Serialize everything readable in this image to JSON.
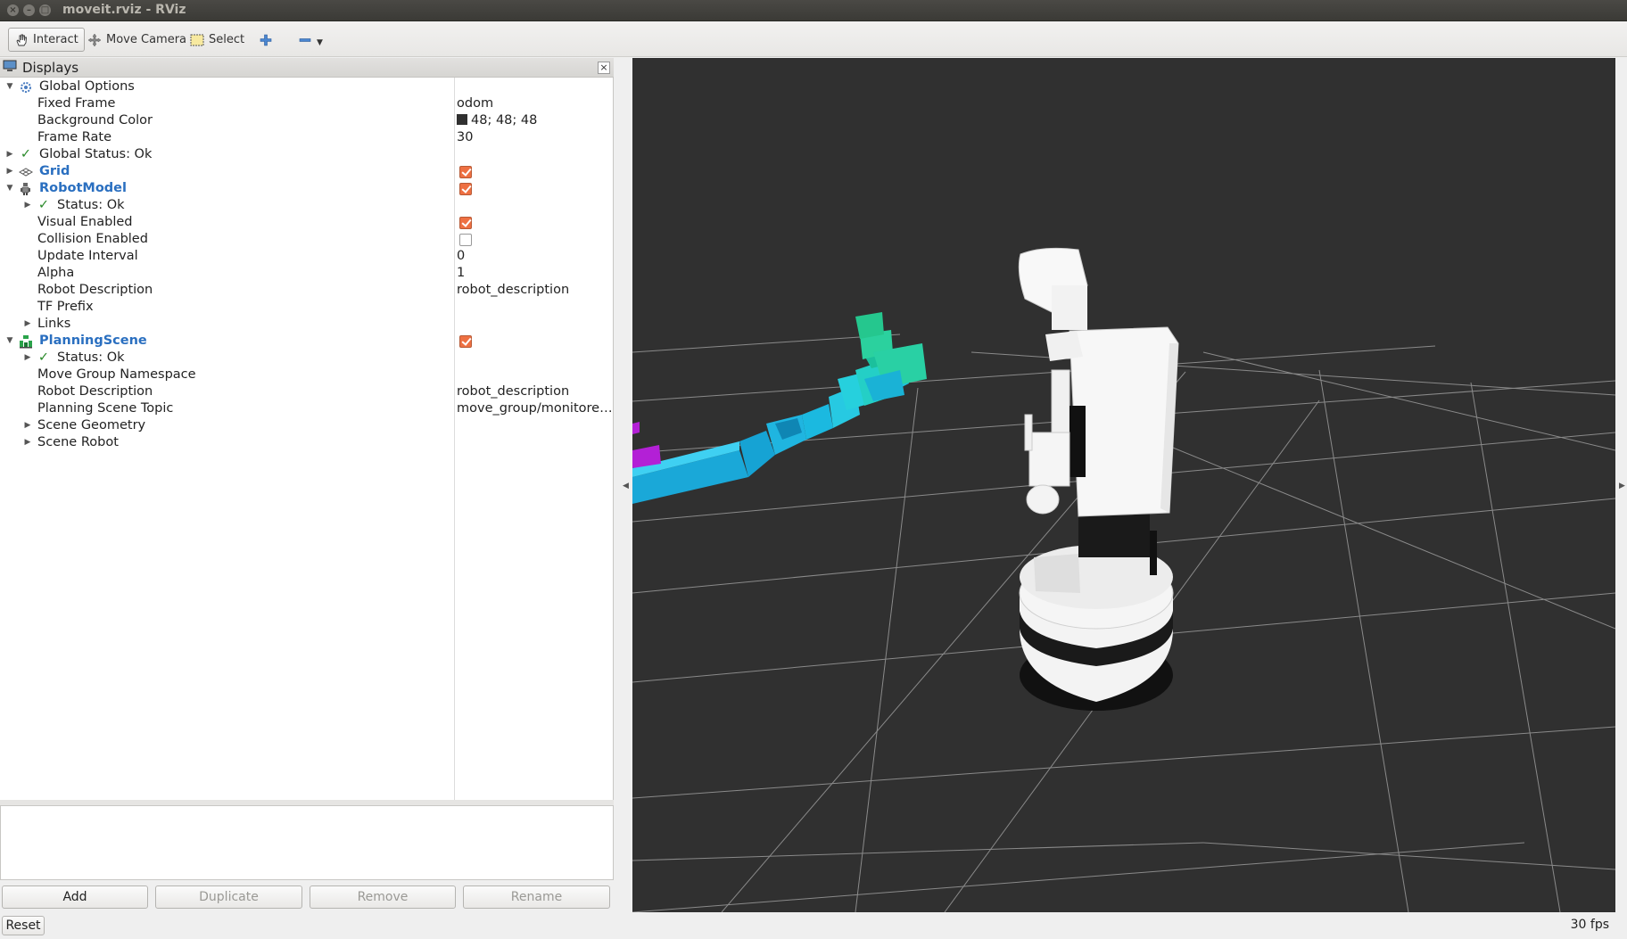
{
  "window": {
    "title": "moveit.rviz - RViz"
  },
  "toolbar": {
    "interact": "Interact",
    "move_camera": "Move Camera",
    "select": "Select"
  },
  "displays": {
    "title": "Displays",
    "rows": [
      {
        "label": "Global Options",
        "value": ""
      },
      {
        "label": "Fixed Frame",
        "value": "odom"
      },
      {
        "label": "Background Color",
        "value": "48; 48; 48"
      },
      {
        "label": "Frame Rate",
        "value": "30"
      },
      {
        "label": "Global Status: Ok",
        "value": ""
      },
      {
        "label": "Grid",
        "value": ""
      },
      {
        "label": "RobotModel",
        "value": ""
      },
      {
        "label": "Status: Ok",
        "value": ""
      },
      {
        "label": "Visual Enabled",
        "value": ""
      },
      {
        "label": "Collision Enabled",
        "value": ""
      },
      {
        "label": "Update Interval",
        "value": "0"
      },
      {
        "label": "Alpha",
        "value": "1"
      },
      {
        "label": "Robot Description",
        "value": "robot_description"
      },
      {
        "label": "TF Prefix",
        "value": ""
      },
      {
        "label": "Links",
        "value": ""
      },
      {
        "label": "PlanningScene",
        "value": ""
      },
      {
        "label": "Status: Ok",
        "value": ""
      },
      {
        "label": "Move Group Namespace",
        "value": ""
      },
      {
        "label": "Robot Description",
        "value": "robot_description"
      },
      {
        "label": "Planning Scene Topic",
        "value": "move_group/monitore…"
      },
      {
        "label": "Scene Geometry",
        "value": ""
      },
      {
        "label": "Scene Robot",
        "value": ""
      }
    ],
    "checks": {
      "grid": true,
      "robot_model": true,
      "visual_enabled": true,
      "collision_enabled": false,
      "planning_scene": true
    }
  },
  "buttons": {
    "add": "Add",
    "duplicate": "Duplicate",
    "remove": "Remove",
    "rename": "Rename"
  },
  "status": {
    "reset": "Reset",
    "fps": "30 fps"
  },
  "colors": {
    "viewport_bg": "#303030",
    "checkbox_on": "#ee7042",
    "display_link": "#2a6fc0"
  }
}
